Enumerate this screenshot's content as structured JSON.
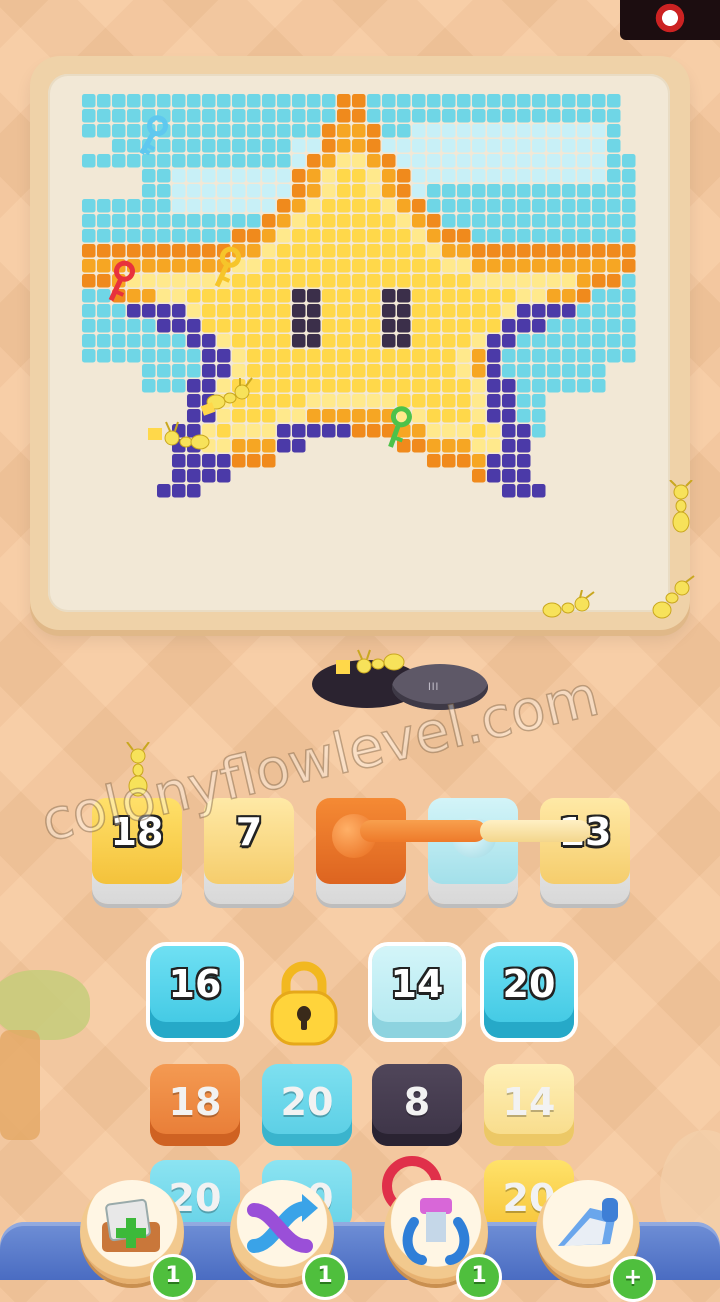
{
  "board": {
    "art": "pixel-star",
    "colors": {
      "sky": "#6fd6e6",
      "cloud": "#c8f0f7",
      "star_yellow": "#ffd84a",
      "star_light": "#ffe98c",
      "star_orange": "#f6a623",
      "star_edge": "#f08a1c",
      "star_purple": "#4b3aa8",
      "eyes": "#3b2f4a"
    }
  },
  "keys": [
    {
      "name": "blue-key-icon",
      "color": "#5fc8ef"
    },
    {
      "name": "red-key-icon",
      "color": "#e8323c"
    },
    {
      "name": "yellow-key-icon",
      "color": "#f6c52a"
    },
    {
      "name": "green-key-icon",
      "color": "#4cc24a"
    }
  ],
  "watermark": "colonyflowlevel.com",
  "slots": [
    {
      "value": "18",
      "color": "#ffd84a",
      "shade": "#f2b531"
    },
    {
      "value": "7",
      "color": "#ffe18f",
      "shade": "#f2c667"
    },
    {
      "value": "",
      "color": "#f17f2a",
      "shade": "#d9611a"
    },
    {
      "value": "",
      "color": "#bdeef4",
      "shade": "#8cd6e3"
    },
    {
      "value": "13",
      "color": "#ffe18f",
      "shade": "#f2c667"
    }
  ],
  "grid": {
    "row1": [
      {
        "value": "16",
        "color": "#52d4ec",
        "shade": "#2bb2d0",
        "state": "active"
      },
      {
        "value": "lock",
        "color": "#ffd43b"
      },
      {
        "value": "14",
        "color": "#bfeff4",
        "shade": "#94d7e2",
        "state": "active"
      },
      {
        "value": "20",
        "color": "#52d4ec",
        "shade": "#2bb2d0",
        "state": "active"
      }
    ],
    "row2": [
      {
        "value": "18",
        "color": "#f08a3a",
        "shade": "#d8672a"
      },
      {
        "value": "20",
        "color": "#67d6ea",
        "shade": "#3fb8d2"
      },
      {
        "value": "8",
        "color": "#463c4e",
        "shade": "#2f2836"
      },
      {
        "value": "14",
        "color": "#ffe8a0",
        "shade": "#f2cf6e"
      }
    ],
    "row3": [
      {
        "value": "20",
        "color": "#67d6ea"
      },
      {
        "value": "20",
        "color": "#67d6ea"
      },
      {
        "value": "",
        "color": "#e0304a"
      },
      {
        "value": "20",
        "color": "#ffd84a"
      }
    ]
  },
  "boosters": [
    {
      "name": "add-slot-booster",
      "count": "1"
    },
    {
      "name": "shuffle-booster",
      "count": "1"
    },
    {
      "name": "magnet-booster",
      "count": "1"
    },
    {
      "name": "vacuum-booster",
      "count": "+"
    }
  ]
}
